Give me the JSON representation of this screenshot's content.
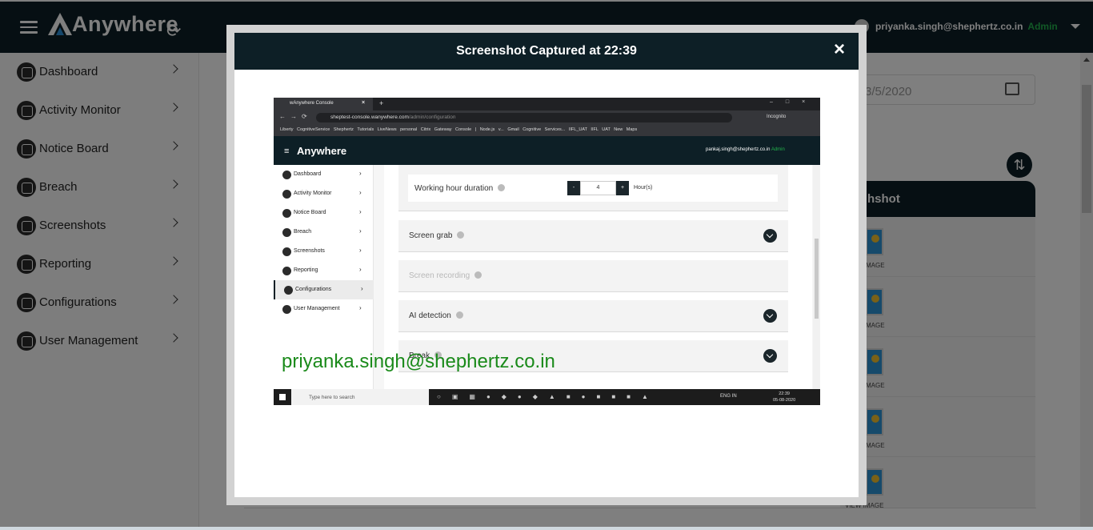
{
  "app": {
    "brand": "Anywhere",
    "sync_icon": "sync-icon",
    "user_email": "priyanka.singh@shephertz.co.in",
    "user_role": "Admin"
  },
  "sidebar": {
    "items": [
      {
        "label": "Dashboard",
        "icon": "dashboard-icon"
      },
      {
        "label": "Activity Monitor",
        "icon": "activity-icon"
      },
      {
        "label": "Notice Board",
        "icon": "notice-icon"
      },
      {
        "label": "Breach",
        "icon": "breach-icon"
      },
      {
        "label": "Screenshots",
        "icon": "screenshots-icon"
      },
      {
        "label": "Reporting",
        "icon": "reporting-icon"
      },
      {
        "label": "Configurations",
        "icon": "configurations-icon"
      },
      {
        "label": "User Management",
        "icon": "user-management-icon"
      }
    ]
  },
  "background": {
    "date_value": "3/5/2020",
    "table_header": "hshot",
    "row_label_short": "MAGE",
    "row_label_full": "VIEW IMAGE"
  },
  "modal": {
    "title": "Screenshot Captured at 22:39",
    "close": "×"
  },
  "screenshot": {
    "tab_title": "wAnywhere Console",
    "url_host": "sheptest-console.wanywhere.com",
    "url_path": "/admin/configuration",
    "incognito": "Incognito",
    "bookmarks": "Liberty   CognitiveService   Shephertz   Tutorials   LiveNews   personal   Citrix Gateway   Console | Node.js v...   Gmail   Cognitive Services...   IIFL_UAT   IIFL UAT New   Maps",
    "brand": "Anywhere",
    "user_email": "pankaj.singh@shephertz.co.in",
    "user_role": "Admin",
    "nav": [
      "Dashboard",
      "Activity Monitor",
      "Notice Board",
      "Breach",
      "Screenshots",
      "Reporting",
      "Configurations",
      "User Management"
    ],
    "active_nav": "Configurations",
    "working_hour_label": "Working hour duration",
    "working_hour_value": "4",
    "working_hour_unit": "Hour(s)",
    "minus": "-",
    "plus": "+",
    "sections": [
      "Screen grab",
      "Screen recording",
      "AI detection",
      "Break"
    ],
    "watermark": "priyanka.singh@shephertz.co.in",
    "taskbar_search": "Type here to search",
    "tray": "ENG IN",
    "clock_time": "22:39",
    "clock_date": "05-08-2020"
  }
}
